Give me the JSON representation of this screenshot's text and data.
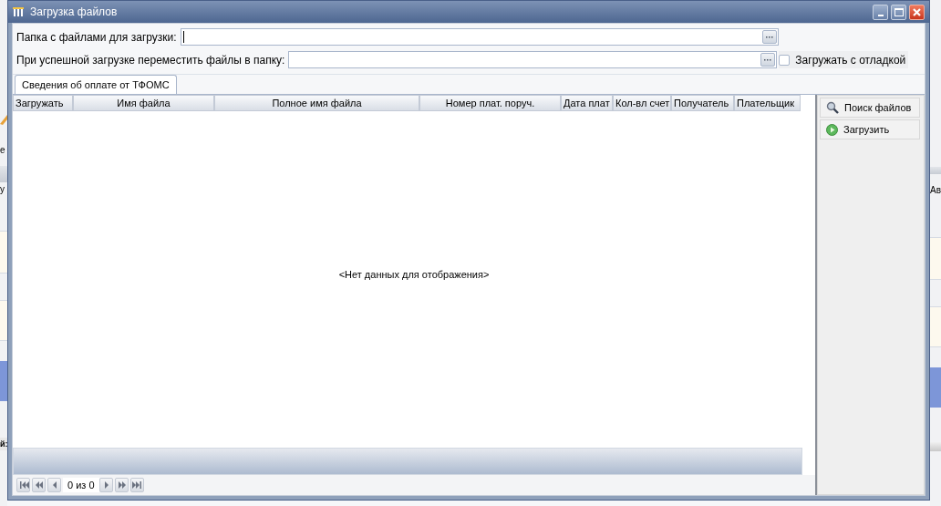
{
  "background": {
    "left": [
      "е",
      "у",
      "й:"
    ],
    "right": [
      "Ав"
    ]
  },
  "window": {
    "title": "Загрузка файлов"
  },
  "fields": [
    {
      "label": "Папка с файлами для загрузки:",
      "focused": true
    },
    {
      "label": "При успешной загрузке переместить файлы в папку:",
      "focused": false
    }
  ],
  "debug_checkbox": {
    "label": "Загружать с отладкой",
    "checked": false
  },
  "tabs": [
    {
      "label": "Сведения об оплате от ТФОМС",
      "selected": true
    }
  ],
  "table": {
    "columns": [
      "Загружать",
      "Имя файла",
      "Полное имя файла",
      "Номер плат. поруч.",
      "Дата плат",
      "Кол-вл счет",
      "Получатель",
      "Плательщик"
    ],
    "empty_text": "<Нет данных для отображения>"
  },
  "side_buttons": [
    {
      "label": "Поиск файлов",
      "kind": "search"
    },
    {
      "label": "Загрузить",
      "kind": "run"
    }
  ],
  "pager": {
    "text": "0 из 0"
  }
}
